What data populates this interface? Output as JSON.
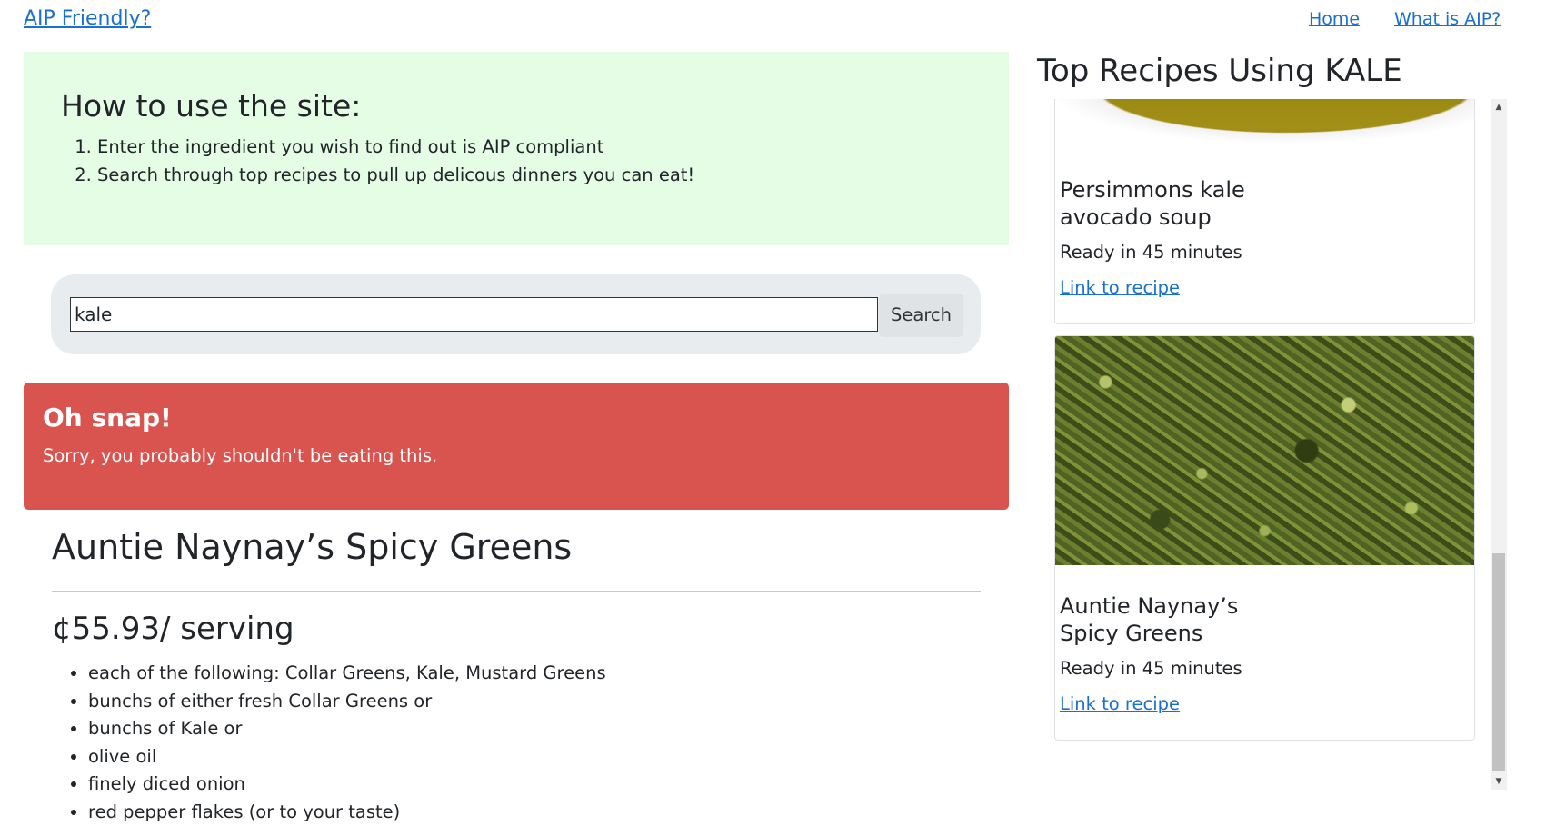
{
  "nav": {
    "brand": "AIP Friendly?",
    "links": [
      "Home",
      "What is AIP?"
    ]
  },
  "howto": {
    "title": "How to use the site:",
    "steps": [
      "Enter the ingredient you wish to find out is AIP compliant",
      "Search through top recipes to pull up delicous dinners you can eat!"
    ]
  },
  "search": {
    "value": "kale",
    "button_label": "Search"
  },
  "alert": {
    "heading": "Oh snap!",
    "message": "Sorry, you probably shouldn't be eating this."
  },
  "recipe": {
    "title": "Auntie Naynay’s Spicy Greens",
    "price": "¢55.93/ serving",
    "ingredients": [
      "each of the following: Collar Greens, Kale, Mustard Greens",
      "bunchs of either fresh Collar Greens or",
      "bunchs of Kale or",
      "olive oil",
      "finely diced onion",
      "red pepper flakes (or to your taste)"
    ]
  },
  "sidebar": {
    "title": "Top Recipes Using KALE",
    "cards": [
      {
        "title": "Persimmons kale avocado soup",
        "ready": "Ready in 45 minutes",
        "link": "Link to recipe"
      },
      {
        "title": "Auntie Naynay’s Spicy Greens",
        "ready": "Ready in 45 minutes",
        "link": "Link to recipe"
      }
    ]
  },
  "colors": {
    "howto_bg": "#e4fde4",
    "alert_bg": "#d9534f",
    "link": "#1a6fd4"
  }
}
